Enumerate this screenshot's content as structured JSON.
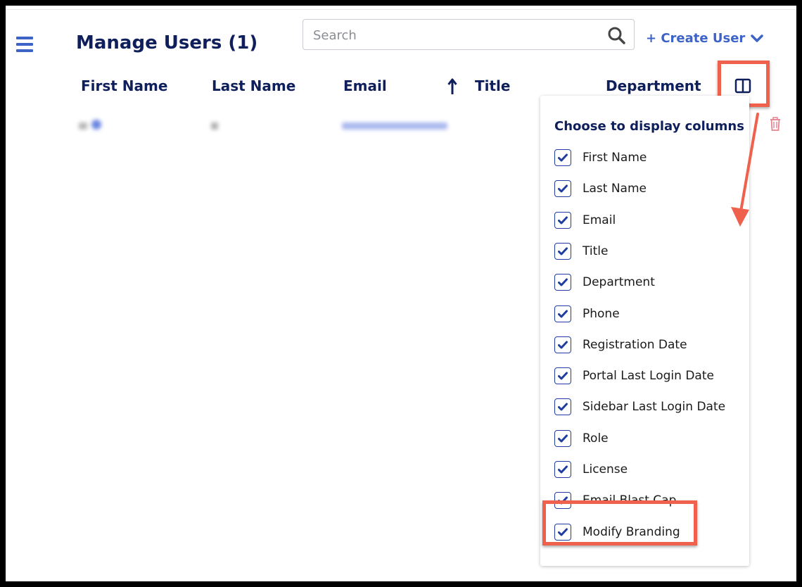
{
  "header": {
    "title": "Manage Users (1)",
    "search_placeholder": "Search",
    "search_value": "",
    "create_user_label": "+ Create User"
  },
  "table": {
    "columns": [
      "First Name",
      "Last Name",
      "Email",
      "Title",
      "Department"
    ],
    "sorted_column": "Email",
    "sort_direction": "ascending"
  },
  "column_chooser": {
    "title": "Choose to display columns",
    "options": [
      {
        "label": "First Name",
        "checked": true
      },
      {
        "label": "Last Name",
        "checked": true
      },
      {
        "label": "Email",
        "checked": true
      },
      {
        "label": "Title",
        "checked": true
      },
      {
        "label": "Department",
        "checked": true
      },
      {
        "label": "Phone",
        "checked": true
      },
      {
        "label": "Registration Date",
        "checked": true
      },
      {
        "label": "Portal Last Login Date",
        "checked": true
      },
      {
        "label": "Sidebar Last Login Date",
        "checked": true
      },
      {
        "label": "Role",
        "checked": true
      },
      {
        "label": "License",
        "checked": true
      },
      {
        "label": "Email Blast Cap",
        "checked": true
      },
      {
        "label": "Modify Branding",
        "checked": true
      }
    ]
  },
  "icons": {
    "menu": "hamburger-menu-icon",
    "search": "search-icon",
    "create_chevron": "chevron-down-icon",
    "sort": "arrow-up-icon",
    "columns": "columns-icon",
    "delete": "trash-icon",
    "check": "checkmark-icon"
  },
  "colors": {
    "heading": "#0f1f5c",
    "accent": "#3d63c9",
    "annotation": "#f0614d",
    "delete": "#e8828f"
  }
}
